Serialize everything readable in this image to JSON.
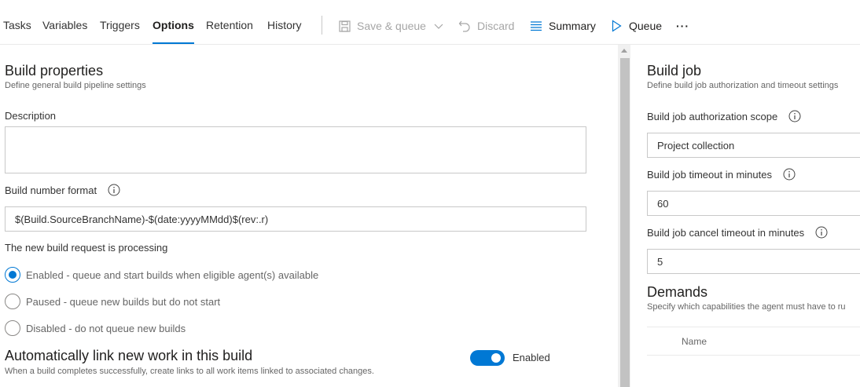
{
  "tabs": [
    {
      "label": "Tasks"
    },
    {
      "label": "Variables"
    },
    {
      "label": "Triggers"
    },
    {
      "label": "Options"
    },
    {
      "label": "Retention"
    },
    {
      "label": "History"
    }
  ],
  "toolbar": {
    "save_queue": "Save & queue",
    "discard": "Discard",
    "summary": "Summary",
    "queue": "Queue",
    "more": "···"
  },
  "build_properties": {
    "title": "Build properties",
    "subtitle": "Define general build pipeline settings",
    "description_label": "Description",
    "description_value": "",
    "build_number_label": "Build number format",
    "build_number_value": "$(Build.SourceBranchName)-$(date:yyyyMMdd)$(rev:.r)",
    "processing_label": "The new build request is processing",
    "options": [
      {
        "label": "Enabled - queue and start builds when eligible agent(s) available",
        "selected": true
      },
      {
        "label": "Paused - queue new builds but do not start",
        "selected": false
      },
      {
        "label": "Disabled - do not queue new builds",
        "selected": false
      }
    ]
  },
  "auto_link": {
    "title": "Automatically link new work in this build",
    "subtitle": "When a build completes successfully, create links to all work items linked to associated changes.",
    "toggle_label": "Enabled",
    "enabled": true
  },
  "build_job": {
    "title": "Build job",
    "subtitle": "Define build job authorization and timeout settings",
    "scope_label": "Build job authorization scope",
    "scope_value": "Project collection",
    "timeout_label": "Build job timeout in minutes",
    "timeout_value": "60",
    "cancel_label": "Build job cancel timeout in minutes",
    "cancel_value": "5"
  },
  "demands": {
    "title": "Demands",
    "subtitle": "Specify which capabilities the agent must have to ru",
    "column_name": "Name"
  },
  "colors": {
    "accent": "#0078d4",
    "disabled_text": "#a6a6a6"
  }
}
